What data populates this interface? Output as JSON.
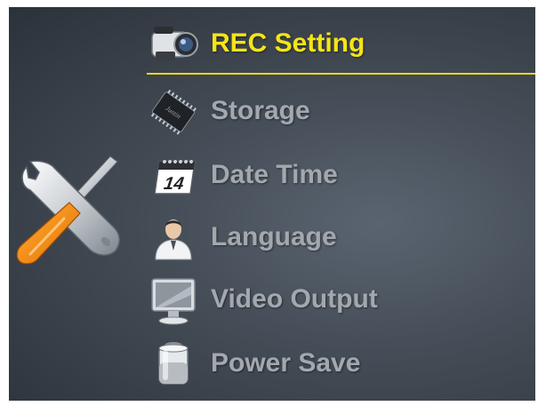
{
  "menu": {
    "items": [
      {
        "label": "REC Setting",
        "icon": "camcorder-icon",
        "selected": true
      },
      {
        "label": "Storage",
        "icon": "memory-chip-icon",
        "selected": false
      },
      {
        "label": "Date Time",
        "icon": "calendar-icon",
        "selected": false
      },
      {
        "label": "Language",
        "icon": "person-icon",
        "selected": false
      },
      {
        "label": "Video Output",
        "icon": "monitor-icon",
        "selected": false
      },
      {
        "label": "Power Save",
        "icon": "battery-icon",
        "selected": false
      }
    ],
    "calendar_day": "14",
    "memory_chip_text": "Justin"
  },
  "colors": {
    "selected_text": "#f4e418",
    "normal_text": "#a3a8ae",
    "underline": "#e8d81a",
    "background": "#434b55"
  },
  "settings_icon": "wrench-screwdriver-icon"
}
